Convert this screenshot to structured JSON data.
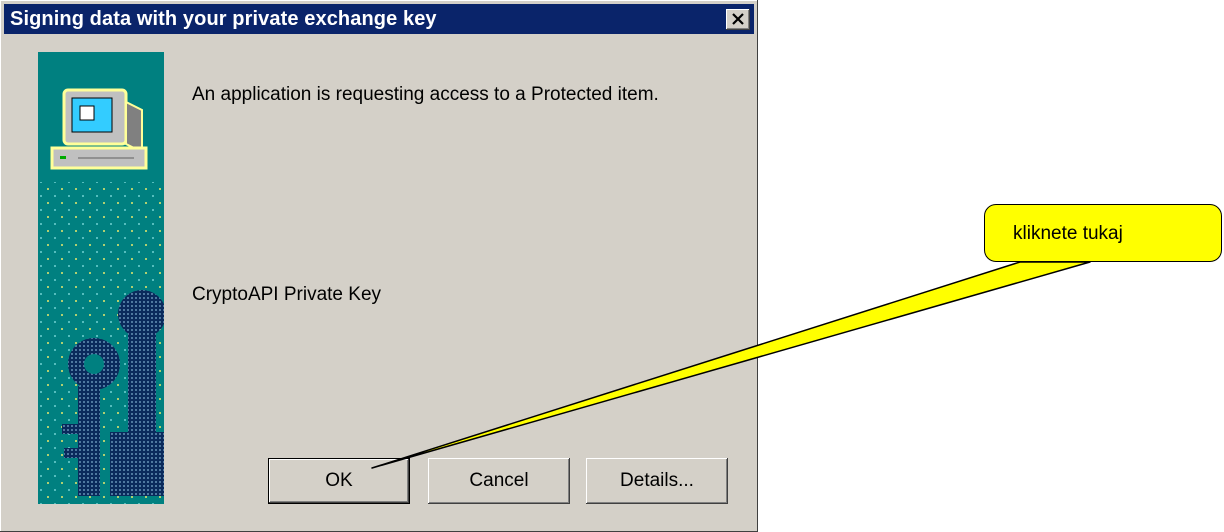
{
  "dialog": {
    "title": "Signing data with your private exchange key",
    "close_glyph": "×",
    "message": "An application is requesting access to a Protected item.",
    "item_name": "CryptoAPI Private Key",
    "buttons": {
      "ok": "OK",
      "cancel": "Cancel",
      "details": "Details..."
    }
  },
  "annotation": {
    "callout_text": "kliknete tukaj",
    "callout_color": "#ffff00"
  },
  "colors": {
    "title_bar": "#0a246a",
    "dialog_bg": "#d4d0c8",
    "side_panel": "#008080"
  },
  "icons": {
    "close": "close-icon",
    "computer": "computer-icon",
    "keys": "keys-icon"
  }
}
